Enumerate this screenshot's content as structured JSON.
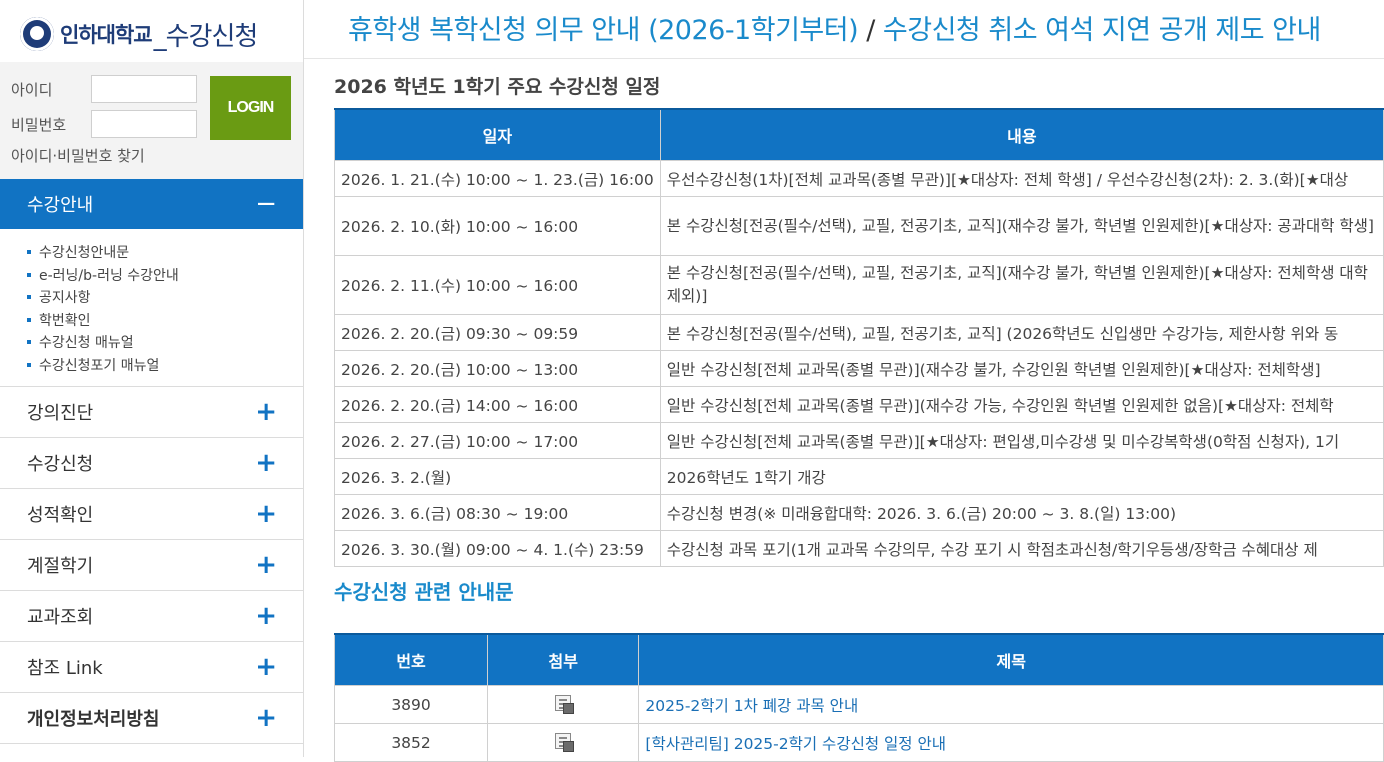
{
  "logo": {
    "univ": "인하대학교",
    "sub": "_수강신청"
  },
  "login": {
    "id_label": "아이디",
    "pw_label": "비밀번호",
    "button": "LOGIN",
    "find": "아이디·비밀번호 찾기"
  },
  "menu": {
    "active": "수강안내",
    "submenu": [
      "수강신청안내문",
      "e-러닝/b-러닝 수강안내",
      "공지사항",
      "학번확인",
      "수강신청 매뉴얼",
      "수강신청포기 매뉴얼"
    ],
    "items": [
      "강의진단",
      "수강신청",
      "성적확인",
      "계절학기",
      "교과조회",
      "참조 Link",
      "개인정보처리방침"
    ]
  },
  "headline": {
    "part1": "휴학생 복학신청 의무 안내 (2026-1학기부터)",
    "slash": " / ",
    "part2": "수강신청 취소 여석 지연 공개 제도 안내"
  },
  "schedule": {
    "title": "2026 학년도 1학기 주요 수강신청 일정",
    "headers": [
      "일자",
      "내용"
    ],
    "rows": [
      [
        "2026. 1. 21.(수) 10:00 ~ 1. 23.(금) 16:00",
        "우선수강신청(1차)[전체 교과목(종별 무관)][★대상자: 전체 학생] / 우선수강신청(2차): 2. 3.(화)[★대상"
      ],
      [
        "2026. 2. 10.(화) 10:00 ~ 16:00",
        "본 수강신청[전공(필수/선택), 교필, 전공기초, 교직](재수강 불가, 학년별 인원제한)[★대상자: 공과대학 학생]"
      ],
      [
        "2026. 2. 11.(수) 10:00 ~ 16:00",
        "본 수강신청[전공(필수/선택), 교필, 전공기초, 교직](재수강 불가, 학년별 인원제한)[★대상자: 전체학생 대학 제외)]"
      ],
      [
        "2026. 2. 20.(금) 09:30 ~ 09:59",
        "본 수강신청[전공(필수/선택), 교필, 전공기초, 교직] (2026학년도 신입생만 수강가능, 제한사항 위와 동"
      ],
      [
        "2026. 2. 20.(금) 10:00 ~ 13:00",
        "일반 수강신청[전체 교과목(종별 무관)](재수강 불가, 수강인원 학년별 인원제한)[★대상자: 전체학생]"
      ],
      [
        "2026. 2. 20.(금) 14:00 ~ 16:00",
        "일반 수강신청[전체 교과목(종별 무관)](재수강 가능, 수강인원 학년별 인원제한 없음)[★대상자: 전체학"
      ],
      [
        "2026. 2. 27.(금) 10:00 ~ 17:00",
        "일반 수강신청[전체 교과목(종별 무관)][★대상자: 편입생,미수강생 및 미수강복학생(0학점 신청자), 1기"
      ],
      [
        "2026. 3. 2.(월)",
        "2026학년도 1학기 개강"
      ],
      [
        "2026. 3. 6.(금) 08:30 ~ 19:00",
        "수강신청 변경(※ 미래융합대학: 2026. 3. 6.(금) 20:00 ~ 3. 8.(일) 13:00)"
      ],
      [
        "2026. 3. 30.(월) 09:00 ~ 4. 1.(수) 23:59",
        "수강신청 과목 포기(1개 교과목 수강의무, 수강 포기 시 학점초과신청/학기우등생/장학금 수혜대상 제"
      ]
    ]
  },
  "notices": {
    "title": "수강신청 관련 안내문",
    "headers": [
      "번호",
      "첨부",
      "제목"
    ],
    "rows": [
      {
        "num": "3890",
        "title": "2025-2학기 1차 폐강 과목 안내"
      },
      {
        "num": "3852",
        "title": "[학사관리팀] 2025-2학기 수강신청 일정 안내"
      }
    ]
  },
  "colors": {
    "primary": "#1173c3",
    "accent_text": "#1a8acb",
    "login_green": "#6a9b13",
    "logo_navy": "#1e3c78"
  }
}
